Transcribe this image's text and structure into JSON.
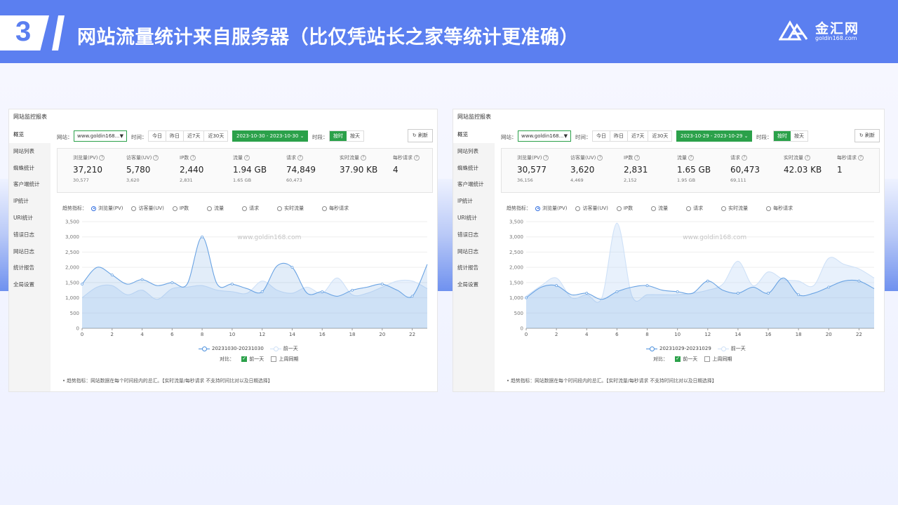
{
  "slide": {
    "number": "3",
    "title": "网站流量统计来自服务器（比仅凭站长之家等统计更准确）",
    "logo_cn": "金汇网",
    "logo_en": "goldin168.com",
    "colors": {
      "header": "#5b7ff0",
      "accent_green": "#2ba14a",
      "series_main": "#4a8fdc",
      "series_prev": "#cfe1f7"
    }
  },
  "panels": [
    {
      "title": "网站监控报表",
      "sidebar": [
        "概览",
        "网站列表",
        "蜘蛛统计",
        "客户端统计",
        "IP统计",
        "URI统计",
        "错误日志",
        "网站日志",
        "统计报告",
        "全局设置"
      ],
      "toolbar": {
        "site_label": "网站：",
        "site_value": "www.goldin168...",
        "time_label": "时间：",
        "ranges": [
          "今日",
          "昨日",
          "近7天",
          "近30天"
        ],
        "date_range": "2023-10-30 - 2023-10-30",
        "period_label": "时段：",
        "period_options": [
          "按时",
          "按天"
        ],
        "refresh": "刷新"
      },
      "stats": [
        {
          "label": "浏览量(PV)",
          "value": "37,210",
          "prev": "30,577"
        },
        {
          "label": "访客量(UV)",
          "value": "5,780",
          "prev": "3,620"
        },
        {
          "label": "IP数",
          "value": "2,440",
          "prev": "2,831"
        },
        {
          "label": "流量",
          "value": "1.94 GB",
          "prev": "1.65 GB"
        },
        {
          "label": "请求",
          "value": "74,849",
          "prev": "60,473"
        },
        {
          "label": "实时流量",
          "value": "37.90 KB",
          "prev": ""
        },
        {
          "label": "每秒请求",
          "value": "4",
          "prev": ""
        }
      ],
      "trend_label": "趋势指标：",
      "trend_options": [
        "浏览量(PV)",
        "访客量(UV)",
        "IP数",
        "流量",
        "请求",
        "实时流量",
        "每秒请求"
      ],
      "watermark": "www.goldin168.com",
      "legend": [
        "20231030-20231030",
        "前一天"
      ],
      "compare_label": "对比：",
      "compare_options": [
        "前一天",
        "上周同期"
      ],
      "note": "• 趋势指标：网站数据在每个时间段内的总汇。【实时流量/每秒请求 不支持时间比对以及日期选择】"
    },
    {
      "title": "网站监控报表",
      "sidebar": [
        "概览",
        "网站列表",
        "蜘蛛统计",
        "客户端统计",
        "IP统计",
        "URI统计",
        "错误日志",
        "网站日志",
        "统计报告",
        "全局设置"
      ],
      "toolbar": {
        "site_label": "网站：",
        "site_value": "www.goldin168...",
        "time_label": "时间：",
        "ranges": [
          "今日",
          "昨日",
          "近7天",
          "近30天"
        ],
        "date_range": "2023-10-29 - 2023-10-29",
        "period_label": "时段：",
        "period_options": [
          "按时",
          "按天"
        ],
        "refresh": "刷新"
      },
      "stats": [
        {
          "label": "浏览量(PV)",
          "value": "30,577",
          "prev": "36,156"
        },
        {
          "label": "访客量(UV)",
          "value": "3,620",
          "prev": "4,469"
        },
        {
          "label": "IP数",
          "value": "2,831",
          "prev": "2,152"
        },
        {
          "label": "流量",
          "value": "1.65 GB",
          "prev": "1.95 GB"
        },
        {
          "label": "请求",
          "value": "60,473",
          "prev": "69,111"
        },
        {
          "label": "实时流量",
          "value": "42.03 KB",
          "prev": ""
        },
        {
          "label": "每秒请求",
          "value": "1",
          "prev": ""
        }
      ],
      "trend_label": "趋势指标：",
      "trend_options": [
        "浏览量(PV)",
        "访客量(UV)",
        "IP数",
        "流量",
        "请求",
        "实时流量",
        "每秒请求"
      ],
      "watermark": "www.goldin168.com",
      "legend": [
        "20231029-20231029",
        "前一天"
      ],
      "compare_label": "对比：",
      "compare_options": [
        "前一天",
        "上周同期"
      ],
      "note": "• 趋势指标：网站数据在每个时间段内的总汇。【实时流量/每秒请求 不支持时间比对以及日期选择】"
    }
  ],
  "chart_data": [
    {
      "type": "area",
      "ylim": [
        0,
        3500
      ],
      "yticks": [
        "0",
        "500",
        "1,000",
        "1,500",
        "2,000",
        "2,500",
        "3,000",
        "3,500"
      ],
      "xlim": [
        0,
        23
      ],
      "xticks": [
        "0",
        "2",
        "4",
        "6",
        "8",
        "10",
        "12",
        "14",
        "16",
        "18",
        "20",
        "22"
      ],
      "series": [
        {
          "name": "20231030-20231030",
          "x": [
            0,
            1,
            2,
            3,
            4,
            5,
            6,
            7,
            8,
            9,
            10,
            11,
            12,
            13,
            14,
            15,
            16,
            17,
            18,
            19,
            20,
            21,
            22,
            23
          ],
          "values": [
            1450,
            2000,
            1750,
            1450,
            1600,
            1400,
            1500,
            1450,
            3000,
            1450,
            1450,
            1300,
            1200,
            2050,
            2000,
            1150,
            1200,
            1050,
            1250,
            1350,
            1450,
            1250,
            1050,
            2100
          ]
        },
        {
          "name": "前一天",
          "x": [
            0,
            1,
            2,
            3,
            4,
            5,
            6,
            7,
            8,
            9,
            10,
            11,
            12,
            13,
            14,
            15,
            16,
            17,
            18,
            19,
            20,
            21,
            22,
            23
          ],
          "values": [
            1000,
            1350,
            1400,
            1100,
            1250,
            950,
            1300,
            1350,
            1400,
            1250,
            1200,
            1150,
            1550,
            1250,
            1150,
            1350,
            1150,
            1650,
            1100,
            1150,
            1350,
            1550,
            1550,
            1300
          ]
        }
      ]
    },
    {
      "type": "area",
      "ylim": [
        0,
        3500
      ],
      "yticks": [
        "0",
        "500",
        "1,000",
        "1,500",
        "2,000",
        "2,500",
        "3,000",
        "3,500"
      ],
      "xlim": [
        0,
        23
      ],
      "xticks": [
        "0",
        "2",
        "4",
        "6",
        "8",
        "10",
        "12",
        "14",
        "16",
        "18",
        "20",
        "22"
      ],
      "series": [
        {
          "name": "20231029-20231029",
          "x": [
            0,
            1,
            2,
            3,
            4,
            5,
            6,
            7,
            8,
            9,
            10,
            11,
            12,
            13,
            14,
            15,
            16,
            17,
            18,
            19,
            20,
            21,
            22,
            23
          ],
          "values": [
            1000,
            1350,
            1400,
            1100,
            1150,
            950,
            1200,
            1350,
            1400,
            1250,
            1200,
            1150,
            1550,
            1250,
            1150,
            1350,
            1150,
            1650,
            1100,
            1150,
            1350,
            1550,
            1550,
            1300
          ]
        },
        {
          "name": "前一天",
          "x": [
            0,
            1,
            2,
            3,
            4,
            5,
            6,
            7,
            8,
            9,
            10,
            11,
            12,
            13,
            14,
            15,
            16,
            17,
            18,
            19,
            20,
            21,
            22,
            23
          ],
          "values": [
            1050,
            1400,
            1650,
            1000,
            1100,
            1000,
            3450,
            1050,
            1100,
            1100,
            1100,
            1150,
            1250,
            1450,
            2200,
            1400,
            1850,
            1600,
            1550,
            1400,
            2300,
            2100,
            1950,
            1650
          ]
        }
      ]
    }
  ]
}
